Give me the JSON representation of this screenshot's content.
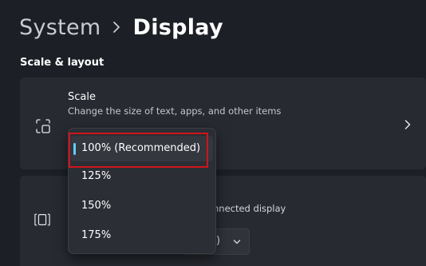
{
  "breadcrumb": {
    "parent": "System",
    "current": "Display"
  },
  "section": {
    "scale_layout_header": "Scale & layout"
  },
  "scale_row": {
    "title": "Scale",
    "description": "Change the size of text, apps, and other items",
    "icon": "scale-icon"
  },
  "scale_menu": {
    "options": [
      {
        "label": "100% (Recommended)",
        "selected": true
      },
      {
        "label": "125%",
        "selected": false
      },
      {
        "label": "150%",
        "selected": false
      },
      {
        "label": "175%",
        "selected": false
      }
    ]
  },
  "multi_display_row": {
    "description_visible": "nnected display",
    "dropdown_value_visible": ")",
    "icon": "multiple-displays-icon"
  },
  "colors": {
    "accent": "#60cdff",
    "highlight_box": "#d2141b",
    "background": "#1c1f26",
    "card": "#272a31"
  }
}
